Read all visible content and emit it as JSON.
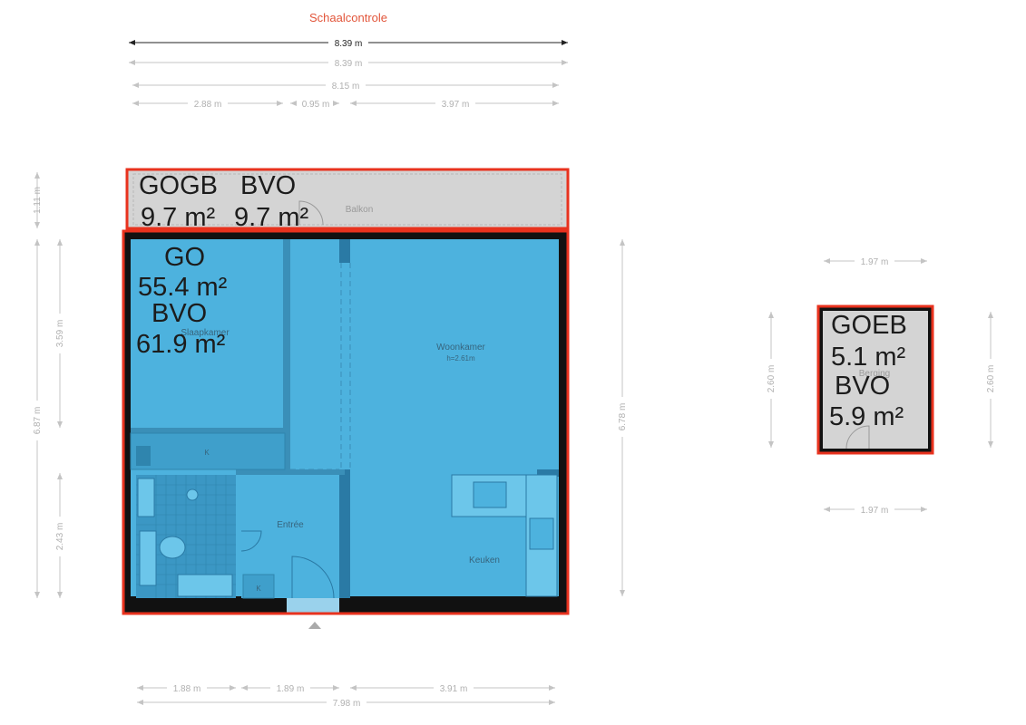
{
  "header": {
    "title": "Schaalcontrole"
  },
  "dimensions": {
    "top_main": "8.39 m",
    "top_second": "8.39 m",
    "top_third": "8.15 m",
    "top_seg_1": "2.88 m",
    "top_seg_2": "0.95 m",
    "top_seg_3": "3.97 m",
    "left_balcony": "1.11 m",
    "left_total": "6.87 m",
    "left_upper": "3.59 m",
    "left_lower": "2.43 m",
    "right_total": "6.78 m",
    "bottom_seg_1": "1.88 m",
    "bottom_seg_2": "1.89 m",
    "bottom_seg_3": "3.91 m",
    "bottom_total": "7.98 m",
    "storage_top": "1.97 m",
    "storage_bottom": "1.97 m",
    "storage_left": "2.60 m",
    "storage_right": "2.60 m"
  },
  "rooms": {
    "balkon": "Balkon",
    "slaapkamer": "Slaapkamer",
    "woonkamer": "Woonkamer",
    "woonkamer_height": "h=2.61m",
    "entree": "Entrée",
    "keuken": "Keuken",
    "kast_1": "K",
    "kast_2": "K",
    "berging": "Berging"
  },
  "areas": {
    "balcony": {
      "label_1": "GOGB",
      "value_1": "9.7 m²",
      "label_2": "BVO",
      "value_2": "9.7 m²"
    },
    "main": {
      "label_1": "GO",
      "value_1": "55.4 m²",
      "label_2": "BVO",
      "value_2": "61.9 m²"
    },
    "storage": {
      "label_1": "GOEB",
      "value_1": "5.1 m²",
      "label_2": "BVO",
      "value_2": "5.9 m²"
    }
  },
  "colors": {
    "overlay_blue": "#4db2de",
    "outline_red": "#e8321e",
    "wall_black": "#111111",
    "balcony_gray": "#d4d4d4",
    "title_red": "#e2553a"
  }
}
